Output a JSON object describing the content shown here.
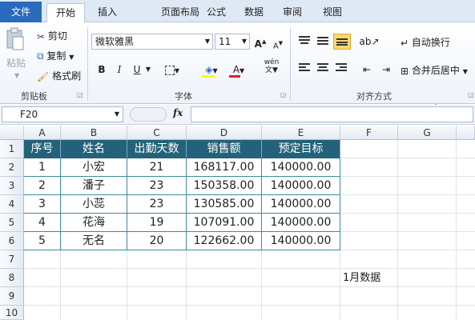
{
  "tabs": [
    "文件",
    "开始",
    "插入",
    "页面布局",
    "公式",
    "数据",
    "审阅",
    "视图"
  ],
  "clipboard": {
    "paste_label": "粘贴",
    "cut_label": "剪切",
    "copy_label": "复制",
    "format_painter_label": "格式刷",
    "group_label": "剪贴板"
  },
  "font": {
    "font_name": "微软雅黑",
    "font_size": "11",
    "bold": "B",
    "italic": "I",
    "underline": "U",
    "grow": "A",
    "shrink": "A",
    "font_color": "A",
    "phonetic": "wén",
    "group_label": "字体"
  },
  "alignment": {
    "wrap_text_label": "自动换行",
    "merge_center_label": "合并后居中",
    "group_label": "对齐方式"
  },
  "formula_bar": {
    "name_box": "F20",
    "fx": "fx",
    "formula": ""
  },
  "columns": [
    "A",
    "B",
    "C",
    "D",
    "E",
    "F",
    "G"
  ],
  "rows": [
    "1",
    "2",
    "3",
    "4",
    "5",
    "6",
    "7",
    "8",
    "9",
    "10"
  ],
  "table": {
    "headers": [
      "序号",
      "姓名",
      "出勤天数",
      "销售额",
      "预定目标"
    ],
    "rows": [
      [
        "1",
        "小宏",
        "21",
        "168117.00",
        "140000.00"
      ],
      [
        "2",
        "潘子",
        "23",
        "150358.00",
        "140000.00"
      ],
      [
        "3",
        "小蕊",
        "23",
        "130585.00",
        "140000.00"
      ],
      [
        "4",
        "花海",
        "19",
        "107091.00",
        "140000.00"
      ],
      [
        "5",
        "无名",
        "20",
        "122662.00",
        "140000.00"
      ]
    ]
  },
  "note_cell": "1月数据",
  "colors": {
    "header_fill": "#23627a",
    "border": "#3f8aa0",
    "file_tab": "#2a6bbd",
    "active_highlight": "#fbd96a"
  }
}
